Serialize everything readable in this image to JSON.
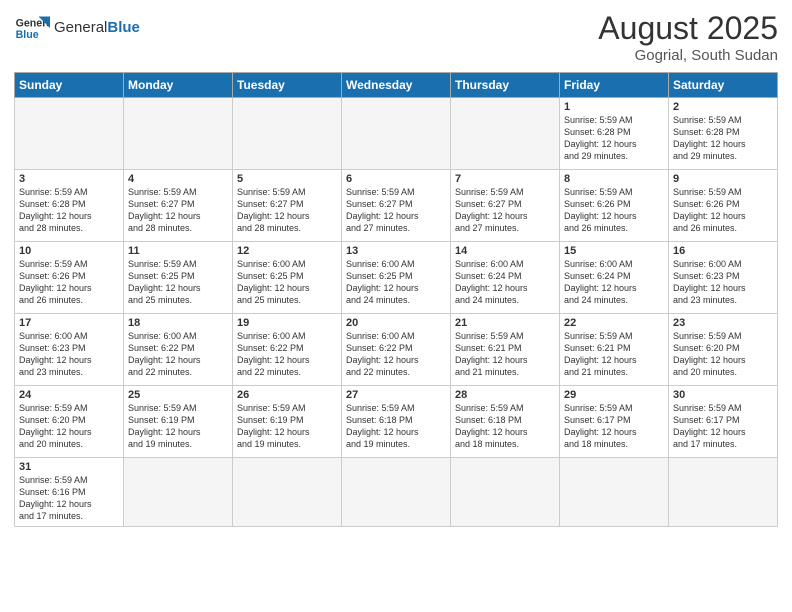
{
  "header": {
    "logo_general": "General",
    "logo_blue": "Blue",
    "month_year": "August 2025",
    "location": "Gogrial, South Sudan"
  },
  "days_of_week": [
    "Sunday",
    "Monday",
    "Tuesday",
    "Wednesday",
    "Thursday",
    "Friday",
    "Saturday"
  ],
  "weeks": [
    [
      {
        "day": "",
        "info": ""
      },
      {
        "day": "",
        "info": ""
      },
      {
        "day": "",
        "info": ""
      },
      {
        "day": "",
        "info": ""
      },
      {
        "day": "",
        "info": ""
      },
      {
        "day": "1",
        "info": "Sunrise: 5:59 AM\nSunset: 6:28 PM\nDaylight: 12 hours\nand 29 minutes."
      },
      {
        "day": "2",
        "info": "Sunrise: 5:59 AM\nSunset: 6:28 PM\nDaylight: 12 hours\nand 29 minutes."
      }
    ],
    [
      {
        "day": "3",
        "info": "Sunrise: 5:59 AM\nSunset: 6:28 PM\nDaylight: 12 hours\nand 28 minutes."
      },
      {
        "day": "4",
        "info": "Sunrise: 5:59 AM\nSunset: 6:27 PM\nDaylight: 12 hours\nand 28 minutes."
      },
      {
        "day": "5",
        "info": "Sunrise: 5:59 AM\nSunset: 6:27 PM\nDaylight: 12 hours\nand 28 minutes."
      },
      {
        "day": "6",
        "info": "Sunrise: 5:59 AM\nSunset: 6:27 PM\nDaylight: 12 hours\nand 27 minutes."
      },
      {
        "day": "7",
        "info": "Sunrise: 5:59 AM\nSunset: 6:27 PM\nDaylight: 12 hours\nand 27 minutes."
      },
      {
        "day": "8",
        "info": "Sunrise: 5:59 AM\nSunset: 6:26 PM\nDaylight: 12 hours\nand 26 minutes."
      },
      {
        "day": "9",
        "info": "Sunrise: 5:59 AM\nSunset: 6:26 PM\nDaylight: 12 hours\nand 26 minutes."
      }
    ],
    [
      {
        "day": "10",
        "info": "Sunrise: 5:59 AM\nSunset: 6:26 PM\nDaylight: 12 hours\nand 26 minutes."
      },
      {
        "day": "11",
        "info": "Sunrise: 5:59 AM\nSunset: 6:25 PM\nDaylight: 12 hours\nand 25 minutes."
      },
      {
        "day": "12",
        "info": "Sunrise: 6:00 AM\nSunset: 6:25 PM\nDaylight: 12 hours\nand 25 minutes."
      },
      {
        "day": "13",
        "info": "Sunrise: 6:00 AM\nSunset: 6:25 PM\nDaylight: 12 hours\nand 24 minutes."
      },
      {
        "day": "14",
        "info": "Sunrise: 6:00 AM\nSunset: 6:24 PM\nDaylight: 12 hours\nand 24 minutes."
      },
      {
        "day": "15",
        "info": "Sunrise: 6:00 AM\nSunset: 6:24 PM\nDaylight: 12 hours\nand 24 minutes."
      },
      {
        "day": "16",
        "info": "Sunrise: 6:00 AM\nSunset: 6:23 PM\nDaylight: 12 hours\nand 23 minutes."
      }
    ],
    [
      {
        "day": "17",
        "info": "Sunrise: 6:00 AM\nSunset: 6:23 PM\nDaylight: 12 hours\nand 23 minutes."
      },
      {
        "day": "18",
        "info": "Sunrise: 6:00 AM\nSunset: 6:22 PM\nDaylight: 12 hours\nand 22 minutes."
      },
      {
        "day": "19",
        "info": "Sunrise: 6:00 AM\nSunset: 6:22 PM\nDaylight: 12 hours\nand 22 minutes."
      },
      {
        "day": "20",
        "info": "Sunrise: 6:00 AM\nSunset: 6:22 PM\nDaylight: 12 hours\nand 22 minutes."
      },
      {
        "day": "21",
        "info": "Sunrise: 5:59 AM\nSunset: 6:21 PM\nDaylight: 12 hours\nand 21 minutes."
      },
      {
        "day": "22",
        "info": "Sunrise: 5:59 AM\nSunset: 6:21 PM\nDaylight: 12 hours\nand 21 minutes."
      },
      {
        "day": "23",
        "info": "Sunrise: 5:59 AM\nSunset: 6:20 PM\nDaylight: 12 hours\nand 20 minutes."
      }
    ],
    [
      {
        "day": "24",
        "info": "Sunrise: 5:59 AM\nSunset: 6:20 PM\nDaylight: 12 hours\nand 20 minutes."
      },
      {
        "day": "25",
        "info": "Sunrise: 5:59 AM\nSunset: 6:19 PM\nDaylight: 12 hours\nand 19 minutes."
      },
      {
        "day": "26",
        "info": "Sunrise: 5:59 AM\nSunset: 6:19 PM\nDaylight: 12 hours\nand 19 minutes."
      },
      {
        "day": "27",
        "info": "Sunrise: 5:59 AM\nSunset: 6:18 PM\nDaylight: 12 hours\nand 19 minutes."
      },
      {
        "day": "28",
        "info": "Sunrise: 5:59 AM\nSunset: 6:18 PM\nDaylight: 12 hours\nand 18 minutes."
      },
      {
        "day": "29",
        "info": "Sunrise: 5:59 AM\nSunset: 6:17 PM\nDaylight: 12 hours\nand 18 minutes."
      },
      {
        "day": "30",
        "info": "Sunrise: 5:59 AM\nSunset: 6:17 PM\nDaylight: 12 hours\nand 17 minutes."
      }
    ],
    [
      {
        "day": "31",
        "info": "Sunrise: 5:59 AM\nSunset: 6:16 PM\nDaylight: 12 hours\nand 17 minutes."
      },
      {
        "day": "",
        "info": ""
      },
      {
        "day": "",
        "info": ""
      },
      {
        "day": "",
        "info": ""
      },
      {
        "day": "",
        "info": ""
      },
      {
        "day": "",
        "info": ""
      },
      {
        "day": "",
        "info": ""
      }
    ]
  ]
}
